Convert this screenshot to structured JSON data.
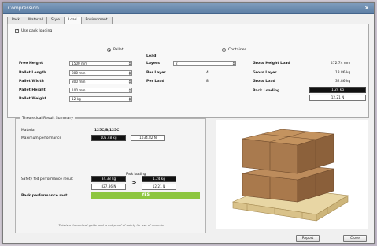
{
  "window": {
    "title": "Compression"
  },
  "tabs": [
    {
      "label": "Pack"
    },
    {
      "label": "Material"
    },
    {
      "label": "Style"
    },
    {
      "label": "Load"
    },
    {
      "label": "Environment"
    }
  ],
  "load": {
    "use_pack_loading": "Use pack loading",
    "pallet_option": "Pallet",
    "container_option": "Container",
    "load_heading": "Load",
    "fields": {
      "free_height": {
        "label": "Free Height",
        "value": "1500 mm"
      },
      "pallet_length": {
        "label": "Pallet Length",
        "value": "800 mm"
      },
      "pallet_width": {
        "label": "Pallet Width",
        "value": "800 mm"
      },
      "pallet_height": {
        "label": "Pallet Height",
        "value": "100 mm"
      },
      "pallet_weight": {
        "label": "Pallet Weight",
        "value": "12 kg"
      }
    },
    "layers": {
      "label": "Layers",
      "value": "2"
    },
    "per_layer": {
      "label": "Per Layer",
      "value": "4"
    },
    "per_load": {
      "label": "Per Load",
      "value": "8"
    },
    "gross_height_load": {
      "label": "Gross Height Load",
      "value": "472.74 mm"
    },
    "gross_layer": {
      "label": "Gross Layer",
      "value": "18.86 kg"
    },
    "gross_load": {
      "label": "Gross Load",
      "value": "32.86 kg"
    },
    "pack_loading": {
      "label": "Pack Loading",
      "value_kg": "1.24 kg",
      "value_n": "12.21 N"
    }
  },
  "result": {
    "title": "Theoretical Result Summary",
    "material_label": "Material",
    "material_value": "125C/B/125C",
    "max_perf_label": "Maximum performance",
    "max_perf_kg": "105.48 kg",
    "max_perf_n": "1034.82 N",
    "safety_label": "Safety fed performance result",
    "safety_kg": "84.38 kg",
    "safety_n": "827.86 N",
    "gt_symbol": ">",
    "pack_loading_heading": "Pack loading",
    "pack_loading_kg": "1.24 kg",
    "pack_loading_n": "12.21 N",
    "pack_perf_label": "Pack performance met",
    "pack_perf_value": "YES",
    "disclaimer": "This is a theoretical guide and is not proof of safety for use of material"
  },
  "buttons": {
    "report": "Report",
    "close": "Close"
  },
  "colors": {
    "accent_green": "#8dc63f",
    "titlebar": "#6b8db3"
  }
}
